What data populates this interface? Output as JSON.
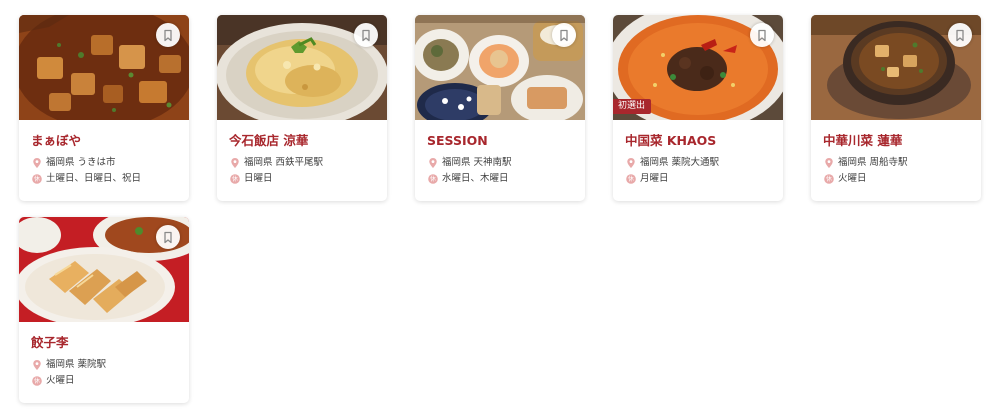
{
  "colors": {
    "accent": "#a8272d",
    "icon_muted": "#e8a9a9",
    "text": "#3f3f3f",
    "card_bg": "#ffffff"
  },
  "cards": [
    {
      "name": "まぁぼや",
      "location": "福岡県 うきは市",
      "holidays": "土曜日、日曜日、祝日",
      "image": "mapo-tofu-photo",
      "badge": ""
    },
    {
      "name": "今石飯店 涼華",
      "location": "福岡県 西鉄平尾駅",
      "holidays": "日曜日",
      "image": "fried-rice-photo",
      "badge": ""
    },
    {
      "name": "SESSION",
      "location": "福岡県 天神南駅",
      "holidays": "水曜日、木曜日",
      "image": "dim-sum-set-photo",
      "badge": ""
    },
    {
      "name": "中国菜 KHAOS",
      "location": "福岡県 薬院大通駅",
      "holidays": "月曜日",
      "image": "tantanmen-photo",
      "badge": "初選出"
    },
    {
      "name": "中華川菜 蓮華",
      "location": "福岡県 周船寺駅",
      "holidays": "火曜日",
      "image": "clay-pot-mapo-photo",
      "badge": ""
    },
    {
      "name": "餃子李",
      "location": "福岡県 薬院駅",
      "holidays": "火曜日",
      "image": "gyoza-photo",
      "badge": ""
    }
  ],
  "icons": {
    "bookmark": "bookmark-icon",
    "location": "location-pin-icon",
    "holiday": "closed-day-icon"
  }
}
